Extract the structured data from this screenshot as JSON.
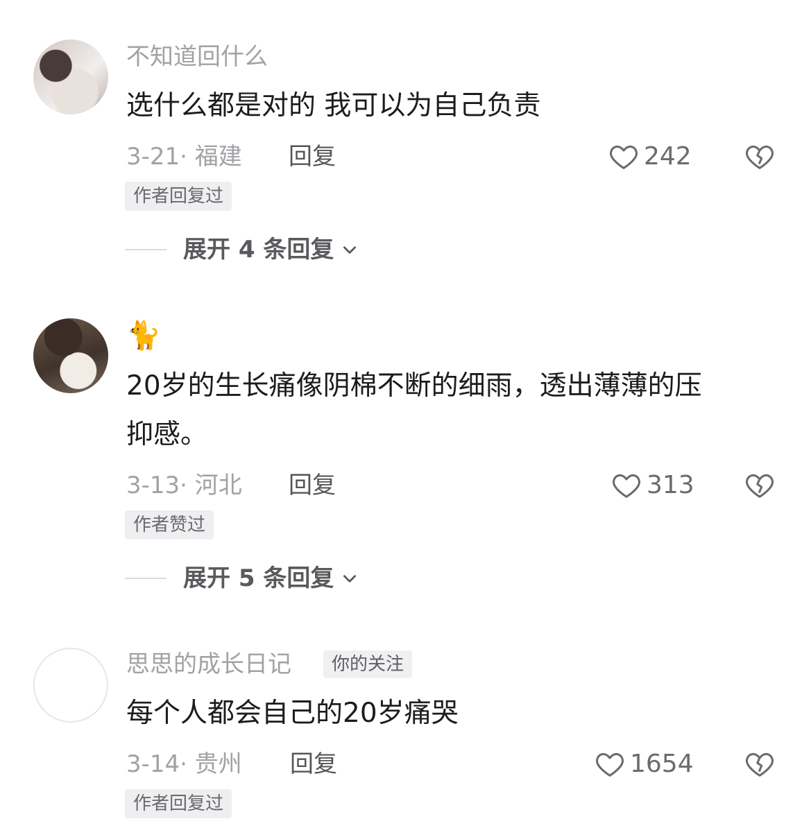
{
  "comments": [
    {
      "username": "不知道回什么",
      "text": "选什么都是对的 我可以为自己负责",
      "meta": "3-21· 福建",
      "reply_label": "回复",
      "likes": "242",
      "badge": "作者回复过",
      "expand_label": "展开 4 条回复"
    },
    {
      "username": "🐈",
      "text_line1": "20岁的生长痛像阴棉不断的细雨，透出薄薄的压",
      "text_line2": "抑感。",
      "meta": "3-13· 河北",
      "reply_label": "回复",
      "likes": "313",
      "badge": "作者赞过",
      "expand_label": "展开 5 条回复"
    },
    {
      "username": "思思的成长日记",
      "follow_tag": "你的关注",
      "text": "每个人都会自己的20岁痛哭",
      "meta": "3-14· 贵州",
      "reply_label": "回复",
      "likes": "1654",
      "badge": "作者回复过"
    }
  ],
  "icons": {
    "like": "heart-outline-icon",
    "dislike": "broken-heart-icon",
    "expand": "chevron-down-icon"
  },
  "colors": {
    "text_primary": "#1c1c1e",
    "text_secondary": "#a2a2a6",
    "badge_bg": "#efeff1"
  }
}
